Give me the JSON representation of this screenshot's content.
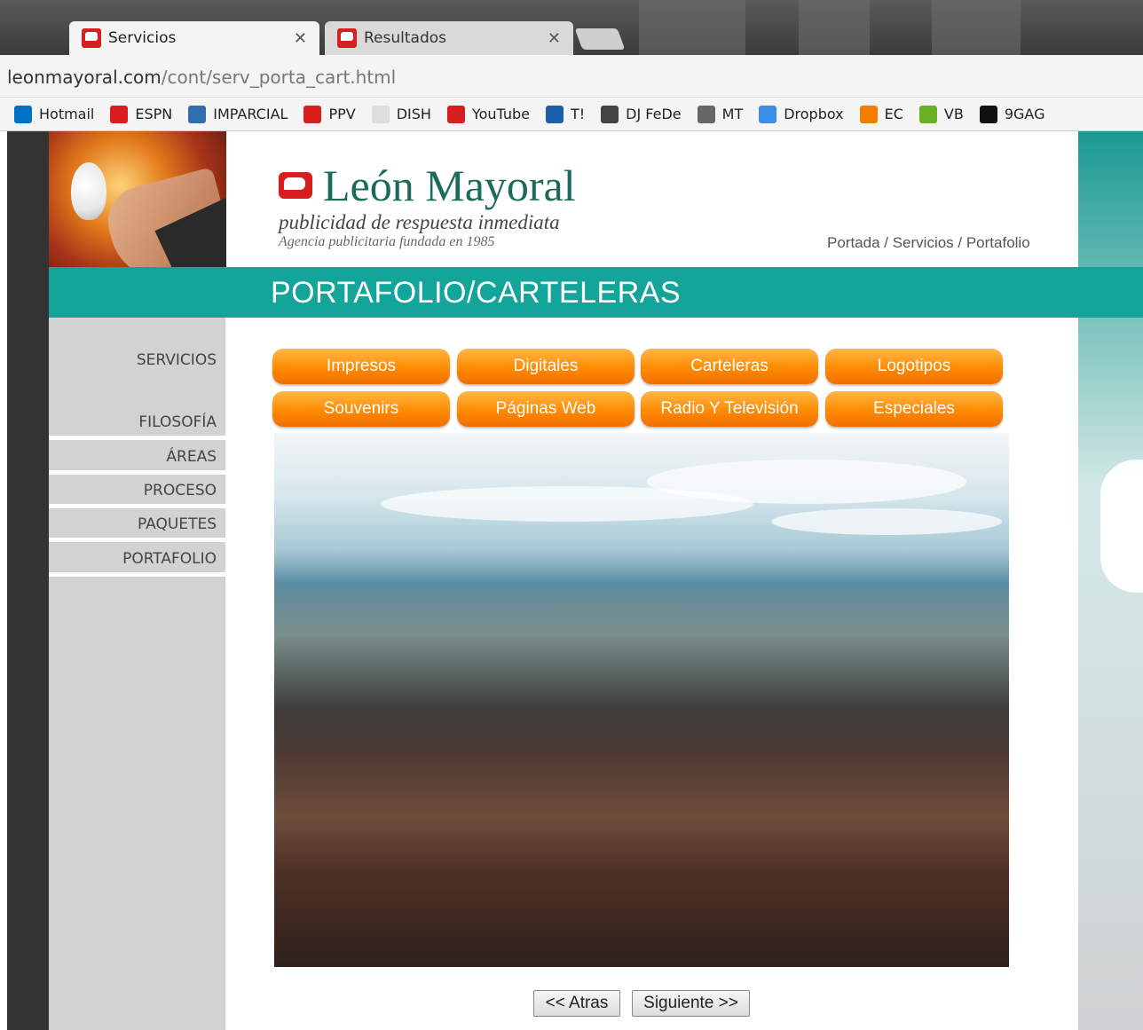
{
  "browser": {
    "tabs": [
      {
        "label": "Servicios",
        "active": true
      },
      {
        "label": "Resultados",
        "active": false
      }
    ],
    "url_host": "leonmayoral.com",
    "url_path": "/cont/serv_porta_cart.html",
    "bookmarks": [
      {
        "label": "Hotmail",
        "icon": "outlook-icon",
        "color": "#0072c6"
      },
      {
        "label": "ESPN",
        "icon": "espn-icon",
        "color": "#d81e1e"
      },
      {
        "label": "IMPARCIAL",
        "icon": "imparcial-icon",
        "color": "#2f6fb0"
      },
      {
        "label": "PPV",
        "icon": "ppv-icon",
        "color": "#d81e1e"
      },
      {
        "label": "DISH",
        "icon": "page-icon",
        "color": "#dddddd"
      },
      {
        "label": "YouTube",
        "icon": "youtube-icon",
        "color": "#d81e1e"
      },
      {
        "label": "T!",
        "icon": "t-icon",
        "color": "#1d5fa8"
      },
      {
        "label": "DJ FeDe",
        "icon": "djfede-icon",
        "color": "#444444"
      },
      {
        "label": "MT",
        "icon": "mt-icon",
        "color": "#666666"
      },
      {
        "label": "Dropbox",
        "icon": "dropbox-icon",
        "color": "#3d8ee6"
      },
      {
        "label": "EC",
        "icon": "blogger-icon",
        "color": "#f57d00"
      },
      {
        "label": "VB",
        "icon": "vb-icon",
        "color": "#6ab023"
      },
      {
        "label": "9GAG",
        "icon": "9gag-icon",
        "color": "#111111"
      }
    ]
  },
  "site": {
    "logo_title": "León Mayoral",
    "slogan": "publicidad de respuesta inmediata",
    "founded": "Agencia publicitaria fundada en 1985",
    "breadcrumb": "Portada / Servicios / Portafolio",
    "banner_title": "PORTAFOLIO/CARTELERAS",
    "sidebar": {
      "heading": "SERVICIOS",
      "items": [
        "FILOSOFÍA",
        "ÁREAS",
        "PROCESO",
        "PAQUETES",
        "PORTAFOLIO"
      ]
    },
    "category_buttons": [
      "Impresos",
      "Digitales",
      "Carteleras",
      "Logotipos",
      "Souvenirs",
      "Páginas Web",
      "Radio Y Televisión",
      "Especiales"
    ],
    "nav": {
      "back": "<< Atras",
      "next": "Siguiente >>"
    }
  },
  "colors": {
    "teal": "#13a49a",
    "orange": "#ff8a00",
    "logo_red": "#d81e1e",
    "logo_green": "#1a6b5a"
  }
}
